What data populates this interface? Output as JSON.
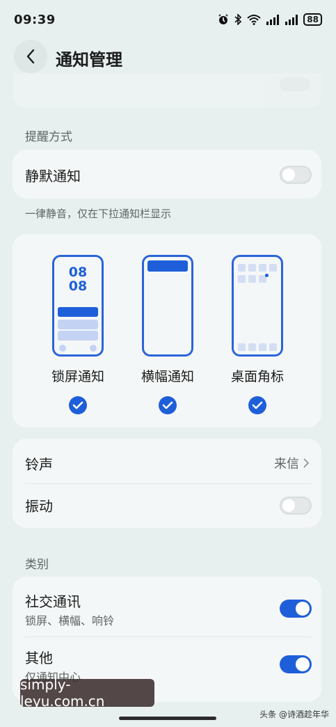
{
  "status_bar": {
    "time": "09:39",
    "battery": "88",
    "icons": [
      "alarm-icon",
      "bluetooth-icon",
      "wifi-icon",
      "signal-icon",
      "signal-icon",
      "battery-icon"
    ]
  },
  "header": {
    "title": "通知管理"
  },
  "sections": {
    "reminder_label": "提醒方式",
    "category_label": "类别"
  },
  "silent": {
    "title": "静默通知",
    "enabled": false,
    "hint": "一律静音，仅在下拉通知栏显示"
  },
  "styles": {
    "lockscreen": {
      "label": "锁屏通知",
      "checked": true,
      "clock_hours": "08",
      "clock_minutes": "08"
    },
    "banner": {
      "label": "横幅通知",
      "checked": true
    },
    "badge": {
      "label": "桌面角标",
      "checked": true
    }
  },
  "sound": {
    "ringtone_label": "铃声",
    "ringtone_value": "来信",
    "vibration_label": "振动",
    "vibration_enabled": false
  },
  "categories": [
    {
      "title": "社交通讯",
      "subtitle": "锁屏、横幅、响铃",
      "enabled": true
    },
    {
      "title": "其他",
      "subtitle": "仅通知中心",
      "enabled": true
    }
  ],
  "watermark": "simply-leyu.com.cn",
  "credit": "头条 @诗酒趁年华",
  "colors": {
    "accent": "#1e5fd9",
    "background": "#e7f0ef",
    "card": "#f4f7f7"
  }
}
